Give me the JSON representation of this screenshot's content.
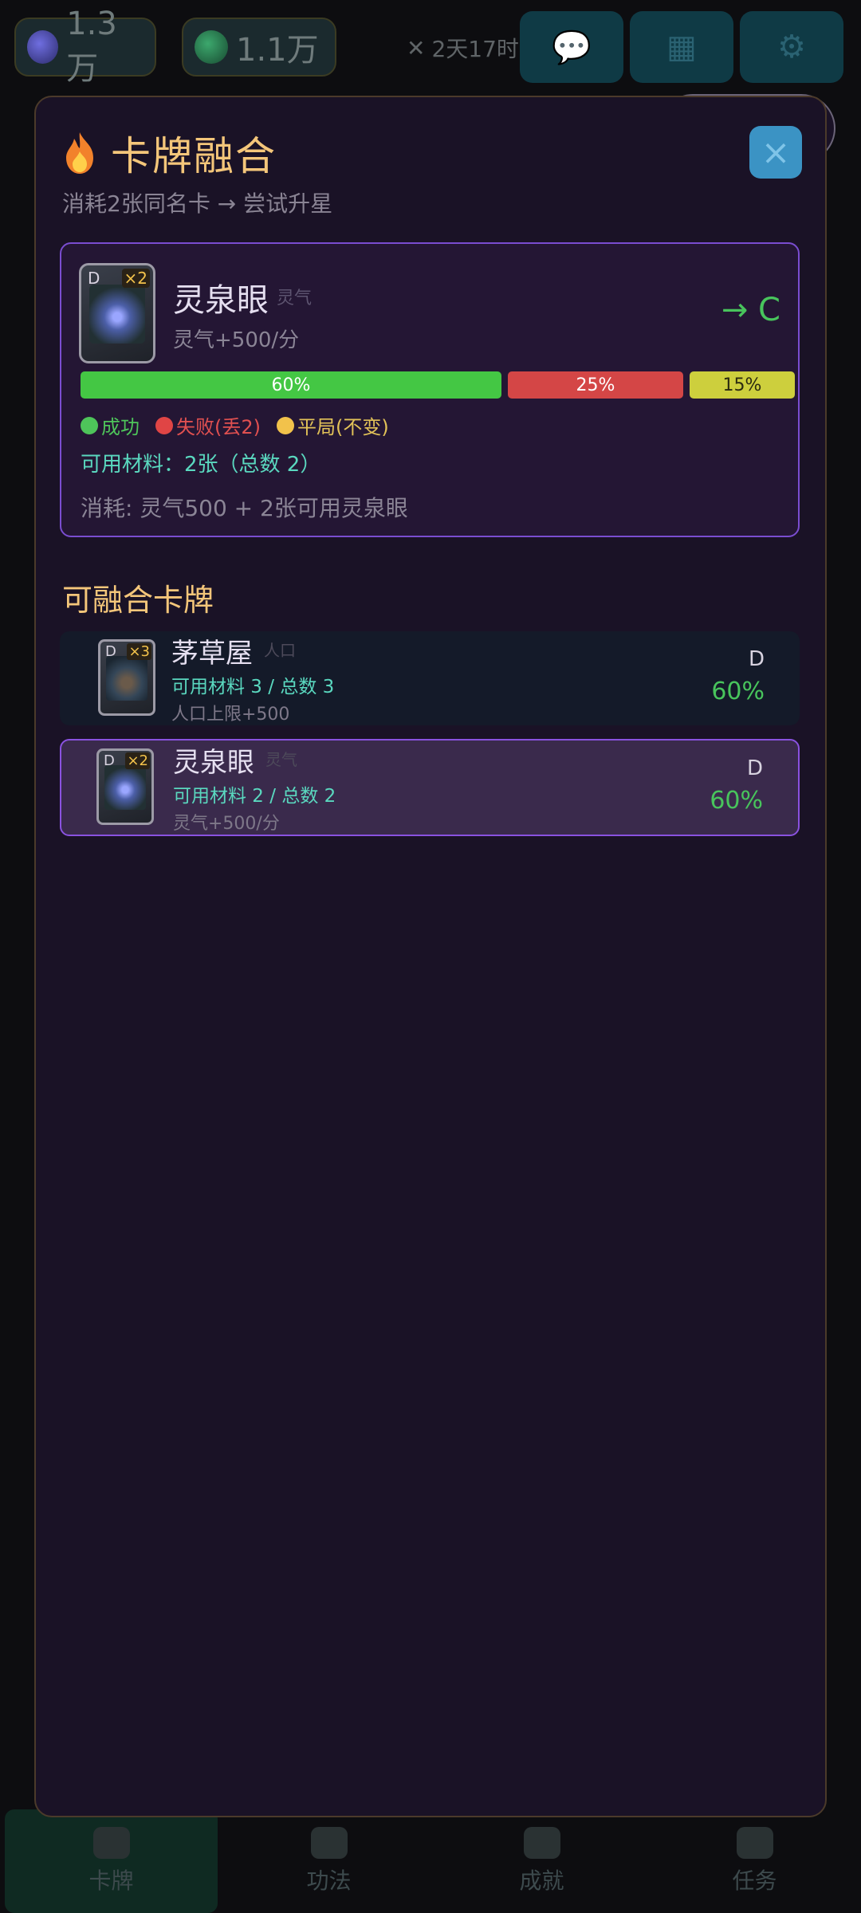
{
  "topbar": {
    "spirit_value": "1.3万",
    "jade_value": "1.1万",
    "timer_text": "2天17时"
  },
  "tabs": [
    {
      "label": "卡牌",
      "active": true
    },
    {
      "label": "功法",
      "active": false
    },
    {
      "label": "成就",
      "active": false
    },
    {
      "label": "任务",
      "active": false
    }
  ],
  "modal": {
    "title": "卡牌融合",
    "subtitle": "消耗2张同名卡 → 尝试升星",
    "close_label": "×",
    "selected": {
      "rank": "D",
      "count": "×2",
      "name": "灵泉眼",
      "tag": "灵气",
      "effect": "灵气+500/分",
      "target": "→ C",
      "probabilities": {
        "success": "60%",
        "fail": "25%",
        "draw": "15%"
      },
      "probability_values": {
        "success": 0.6,
        "fail": 0.25,
        "draw": 0.15
      },
      "legend": {
        "success": "成功",
        "fail": "失败(丢2)",
        "draw": "平局(不变)"
      },
      "materials": "可用材料：2张（总数 2）",
      "cost": "消耗: 灵气500 + 2张可用灵泉眼"
    },
    "section_title": "可融合卡牌",
    "list": [
      {
        "name": "茅草屋",
        "tag": "人口",
        "rank": "D",
        "count": "×3",
        "materials": "可用材料 3 / 总数 3",
        "effect": "人口上限+500",
        "prob": "60%"
      },
      {
        "name": "灵泉眼",
        "tag": "灵气",
        "rank": "D",
        "count": "×2",
        "materials": "可用材料 2 / 总数 2",
        "effect": "灵气+500/分",
        "prob": "60%"
      }
    ]
  },
  "colors": {
    "accent_gold": "#f4c67a",
    "success": "#44c744",
    "fail": "#d44646",
    "draw": "#cdcf3d",
    "selection_border": "#7a4dd0"
  }
}
